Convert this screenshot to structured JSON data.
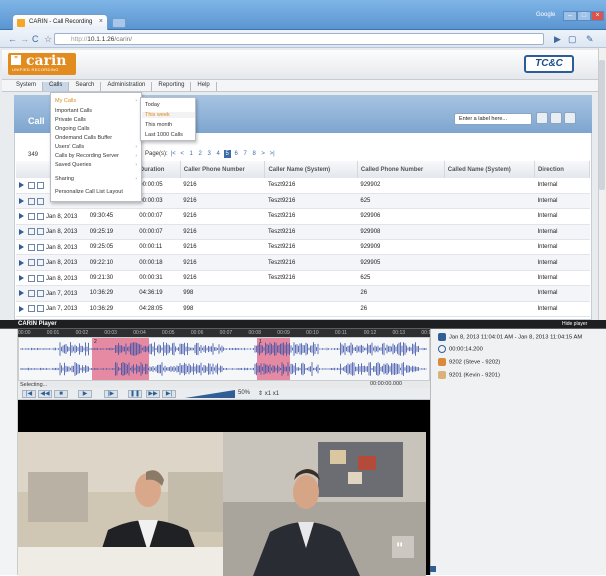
{
  "browser": {
    "tab_title": "CARIN - Call Recording",
    "account_label": "Google",
    "url_scheme": "http://",
    "url_host": "10.1.1.26",
    "url_path": "/carin/"
  },
  "app": {
    "logo_text": "carin",
    "logo_subtext": "UNIFIED RECORDING",
    "partner_logo": "TC&C",
    "menu": [
      "System",
      "Calls",
      "Search",
      "Administration",
      "Reporting",
      "Help"
    ],
    "active_menu": "Calls"
  },
  "calls_menu": {
    "items": [
      {
        "label": "My Calls",
        "highlight": true,
        "submenu": true
      },
      {
        "label": "Important Calls"
      },
      {
        "label": "Private Calls"
      },
      {
        "label": "Ongoing Calls"
      },
      {
        "label": "Ondemand Calls Buffer"
      },
      {
        "label": "Users' Calls",
        "submenu": true
      },
      {
        "label": "Calls by Recording Server",
        "submenu": true
      },
      {
        "label": "Saved Queries",
        "submenu": true
      },
      {
        "label": "Sharing",
        "submenu": true
      },
      {
        "label": "Personalize Call List Layout"
      }
    ],
    "my_calls_submenu": [
      {
        "label": "Today"
      },
      {
        "label": "This week",
        "highlight": true
      },
      {
        "label": "This month"
      },
      {
        "label": "Last 1000 Calls"
      }
    ]
  },
  "panel": {
    "title": "Call",
    "count": "349",
    "label_input_placeholder": "Enter a label here...",
    "pager_label": "Page(s):",
    "pager": [
      "|<",
      "<",
      "1",
      "2",
      "3",
      "4",
      "5",
      "6",
      "7",
      "8",
      ">",
      ">|"
    ],
    "current_page": "5"
  },
  "table": {
    "columns": [
      "",
      "",
      "Duration",
      "Caller Phone Number",
      "Caller Name (System)",
      "Called Phone Number",
      "Called Name (System)",
      "Direction"
    ],
    "rows": [
      {
        "date": "",
        "time": "",
        "duration": "00:00:05",
        "caller_num": "9216",
        "caller_name": "Teszt9216",
        "called_num": "929902",
        "called_name": "",
        "direction": "Internal"
      },
      {
        "date": "",
        "time": "",
        "duration": "00:00:03",
        "caller_num": "9216",
        "caller_name": "Teszt9216",
        "called_num": "625",
        "called_name": "",
        "direction": "Internal"
      },
      {
        "date": "Jan 8, 2013",
        "time": "09:30:45",
        "duration": "00:00:07",
        "caller_num": "9216",
        "caller_name": "Teszt9216",
        "called_num": "929906",
        "called_name": "",
        "direction": "Internal"
      },
      {
        "date": "Jan 8, 2013",
        "time": "09:25:19",
        "duration": "00:00:07",
        "caller_num": "9216",
        "caller_name": "Teszt9216",
        "called_num": "929908",
        "called_name": "",
        "direction": "Internal"
      },
      {
        "date": "Jan 8, 2013",
        "time": "09:25:05",
        "duration": "00:00:11",
        "caller_num": "9216",
        "caller_name": "Teszt9216",
        "called_num": "929909",
        "called_name": "",
        "direction": "Internal"
      },
      {
        "date": "Jan 8, 2013",
        "time": "09:22:10",
        "duration": "00:00:18",
        "caller_num": "9216",
        "caller_name": "Teszt9216",
        "called_num": "929905",
        "called_name": "",
        "direction": "Internal"
      },
      {
        "date": "Jan 8, 2013",
        "time": "09:21:30",
        "duration": "00:00:31",
        "caller_num": "9216",
        "caller_name": "Teszt9216",
        "called_num": "625",
        "called_name": "",
        "direction": "Internal"
      },
      {
        "date": "Jan 7, 2013",
        "time": "10:36:29",
        "duration": "04:36:19",
        "caller_num": "998",
        "caller_name": "",
        "called_num": "26",
        "called_name": "",
        "direction": "Internal"
      },
      {
        "date": "Jan 7, 2013",
        "time": "10:36:29",
        "duration": "04:28:05",
        "caller_num": "998",
        "caller_name": "",
        "called_num": "26",
        "called_name": "",
        "direction": "Internal"
      }
    ]
  },
  "player": {
    "title": "CARIN Player",
    "hide_label": "Hide player",
    "timeline_ticks": [
      "00:00",
      "00:01",
      "00:02",
      "00:03",
      "00:04",
      "00:05",
      "00:06",
      "00:07",
      "00:08",
      "00:09",
      "00:10",
      "00:11",
      "00:12",
      "00:13",
      "00:14"
    ],
    "selection_label": "Selecting...",
    "selection_time": "00:00:00.000",
    "zoom": "50%",
    "speed": "x1",
    "speed2": "x1",
    "info_range": "Jan 8, 2013 11:04:01 AM - Jan 8, 2013 11:04:15 AM",
    "info_duration": "00:00:14.200",
    "party1": "9202 (Steve - 9202)",
    "party2": "9201 (Kevin - 9201)",
    "segment_labels": [
      "2",
      "1"
    ]
  },
  "colors": {
    "accent": "#3b6aa5",
    "logo": "#e28b1f",
    "segment": "#e58aa2"
  }
}
